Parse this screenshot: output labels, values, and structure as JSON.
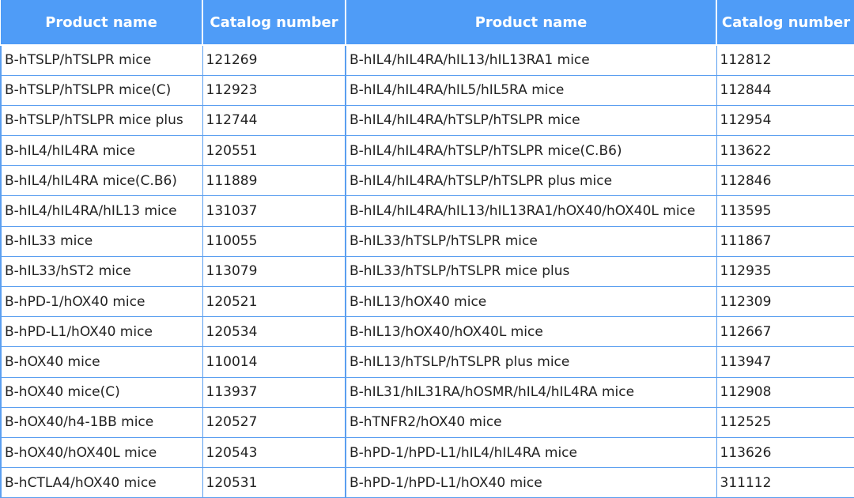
{
  "table": {
    "headers": [
      "Product name",
      "Catalog number",
      "Product name",
      "Catalog number"
    ],
    "rows": [
      {
        "name1": "B-hTSLP/hTSLPR mice",
        "cat1": "121269",
        "name2": "B-hIL4/hIL4RA/hIL13/hIL13RA1 mice",
        "cat2": "112812"
      },
      {
        "name1": "B-hTSLP/hTSLPR mice(C)",
        "cat1": "112923",
        "name2": "B-hIL4/hIL4RA/hIL5/hIL5RA mice",
        "cat2": "112844"
      },
      {
        "name1": "B-hTSLP/hTSLPR mice plus",
        "cat1": "112744",
        "name2": "B-hIL4/hIL4RA/hTSLP/hTSLPR mice",
        "cat2": "112954"
      },
      {
        "name1": "B-hIL4/hIL4RA mice",
        "cat1": "120551",
        "name2": "B-hIL4/hIL4RA/hTSLP/hTSLPR mice(C.B6)",
        "cat2": "113622"
      },
      {
        "name1": "B-hIL4/hIL4RA mice(C.B6)",
        "cat1": "111889",
        "name2": "B-hIL4/hIL4RA/hTSLP/hTSLPR plus mice",
        "cat2": "112846"
      },
      {
        "name1": "B-hIL4/hIL4RA/hIL13 mice",
        "cat1": "131037",
        "name2": "B-hIL4/hIL4RA/hIL13/hIL13RA1/hOX40/hOX40L mice",
        "cat2": "113595"
      },
      {
        "name1": "B-hIL33 mice",
        "cat1": "110055",
        "name2": "B-hIL33/hTSLP/hTSLPR mice",
        "cat2": "111867"
      },
      {
        "name1": "B-hIL33/hST2 mice",
        "cat1": "113079",
        "name2": "B-hIL33/hTSLP/hTSLPR mice plus",
        "cat2": "112935"
      },
      {
        "name1": "B-hPD-1/hOX40 mice",
        "cat1": "120521",
        "name2": "B-hIL13/hOX40 mice",
        "cat2": "112309"
      },
      {
        "name1": "B-hPD-L1/hOX40 mice",
        "cat1": "120534",
        "name2": "B-hIL13/hOX40/hOX40L mice",
        "cat2": "112667"
      },
      {
        "name1": "B-hOX40 mice",
        "cat1": "110014",
        "name2": "B-hIL13/hTSLP/hTSLPR plus mice",
        "cat2": "113947"
      },
      {
        "name1": "B-hOX40 mice(C)",
        "cat1": "113937",
        "name2": "B-hIL31/hIL31RA/hOSMR/hIL4/hIL4RA mice",
        "cat2": "112908"
      },
      {
        "name1": "B-hOX40/h4-1BB mice",
        "cat1": "120527",
        "name2": "B-hTNFR2/hOX40 mice",
        "cat2": "112525"
      },
      {
        "name1": "B-hOX40/hOX40L mice",
        "cat1": "120543",
        "name2": "B-hPD-1/hPD-L1/hIL4/hIL4RA mice",
        "cat2": "113626"
      },
      {
        "name1": "B-hCTLA4/hOX40 mice",
        "cat1": "120531",
        "name2": "B-hPD-1/hPD-L1/hOX40 mice",
        "cat2": "311112"
      }
    ]
  }
}
